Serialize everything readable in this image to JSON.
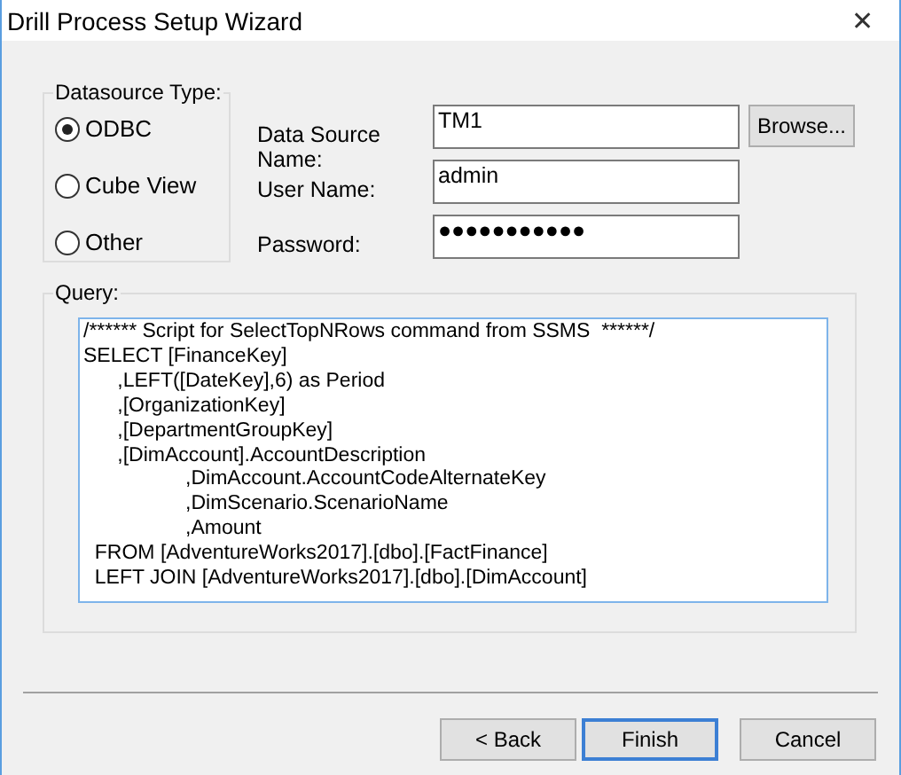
{
  "window": {
    "title": "Drill Process Setup Wizard",
    "close": "✕"
  },
  "datasource_type": {
    "label": "Datasource Type:",
    "options": [
      {
        "label": "ODBC",
        "selected": true
      },
      {
        "label": "Cube View",
        "selected": false
      },
      {
        "label": "Other",
        "selected": false
      }
    ]
  },
  "fields": [
    {
      "label": "Data Source Name:",
      "value": "TM1",
      "button": "Browse..."
    },
    {
      "label": "User Name:",
      "value": "admin"
    },
    {
      "label": "Password:",
      "value": "●●●●●●●●●●●"
    }
  ],
  "query": {
    "label": "Query:",
    "value": "/****** Script for SelectTopNRows command from SSMS  ******/\nSELECT [FinanceKey]\n      ,LEFT([DateKey],6) as Period\n      ,[OrganizationKey]\n      ,[DepartmentGroupKey]\n      ,[DimAccount].AccountDescription\n                  ,DimAccount.AccountCodeAlternateKey\n                  ,DimScenario.ScenarioName\n                  ,Amount\n  FROM [AdventureWorks2017].[dbo].[FactFinance]\n  LEFT JOIN [AdventureWorks2017].[dbo].[DimAccount]"
  },
  "buttons": [
    {
      "label": "< Back",
      "kind": "normal"
    },
    {
      "label": "Finish",
      "kind": "default"
    },
    {
      "label": "Cancel",
      "kind": "normal"
    }
  ]
}
